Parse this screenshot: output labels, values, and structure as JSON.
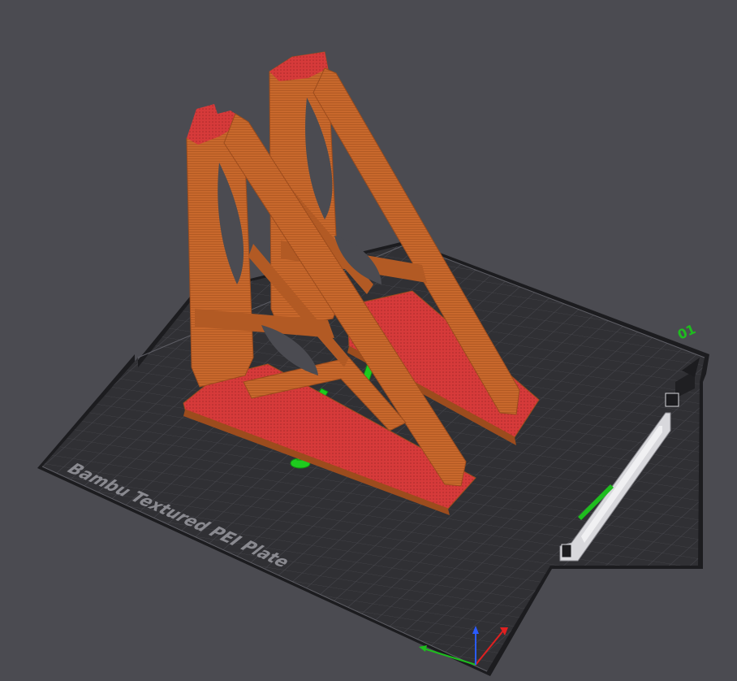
{
  "viewport": {
    "plate_name": "Bambu Textured PEI Plate",
    "plate_number": "01",
    "colors": {
      "background": "#4b4b51",
      "plate": "#303034",
      "plate_edge": "#1c1c1f",
      "grid": "#4a4a50",
      "grid_major": "#5e5e65",
      "model": "#c8682c",
      "model_dark": "#9c4c1d",
      "model_top": "#d33d3d",
      "support": "#1ecc1e",
      "axis_x": "#e02020",
      "axis_y": "#1ebd1e",
      "axis_z": "#2a5bff"
    }
  }
}
